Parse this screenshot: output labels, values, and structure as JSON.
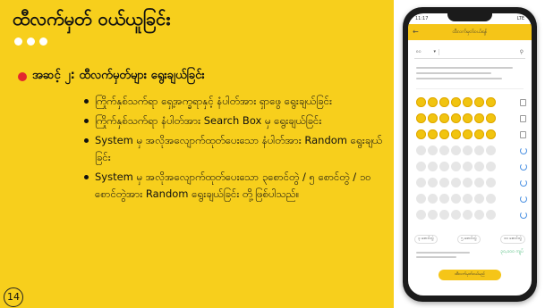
{
  "slide": {
    "title": "ထီလက်မှတ် ဝယ်ယူခြင်း",
    "step_heading": "အဆင့် ၂: ထီလက်မှတ်များ ရွေးချယ်ခြင်း",
    "bullets": [
      "ကြိုက်နှစ်သက်ရာ ရှေ့အက္ခရာနှင့် နံပါတ်အား ရှာဖွေ ရွေးချယ်ခြင်း",
      "ကြိုက်နှစ်သက်ရာ နံပါတ်အား Search Box မှ ရွေးချယ်ခြင်း",
      "System မှ အလိုအလျောက်ထုတ်ပေးသော နံပါတ်အား Random ရွေးချယ်ခြင်း",
      "System မှ အလိုအလျောက်ထုတ်ပေးသော ၃စောင်တွဲ / ၅ စောင်တွဲ / ၁၀ စောင်တွဲအား Random ရွေးချယ်ခြင်း တို့ဖြစ်ပါသည်။"
    ],
    "page_number": "14"
  },
  "phone": {
    "time": "11:17",
    "network": "LTE",
    "screen_title": "ထီလက်မှတ်ဝယ်ရန်",
    "filter_value": "၈၀",
    "bundle_pills": [
      "၃ စောင်တွဲ",
      "၅ စောင်တွဲ",
      "၁၀ စောင်တွဲ"
    ],
    "total_amount": "၃၀,၀၀၀ ကျပ်",
    "buy_button": "ထီလက်မှတ်ဝယ်မည်"
  },
  "colors": {
    "panel": "#f7cf1c",
    "bullet_red": "#e3262e",
    "app_yellow": "#f5c518"
  },
  "icons": [
    "back-arrow-icon",
    "chevron-down-icon",
    "search-icon",
    "trash-icon",
    "refresh-icon"
  ]
}
